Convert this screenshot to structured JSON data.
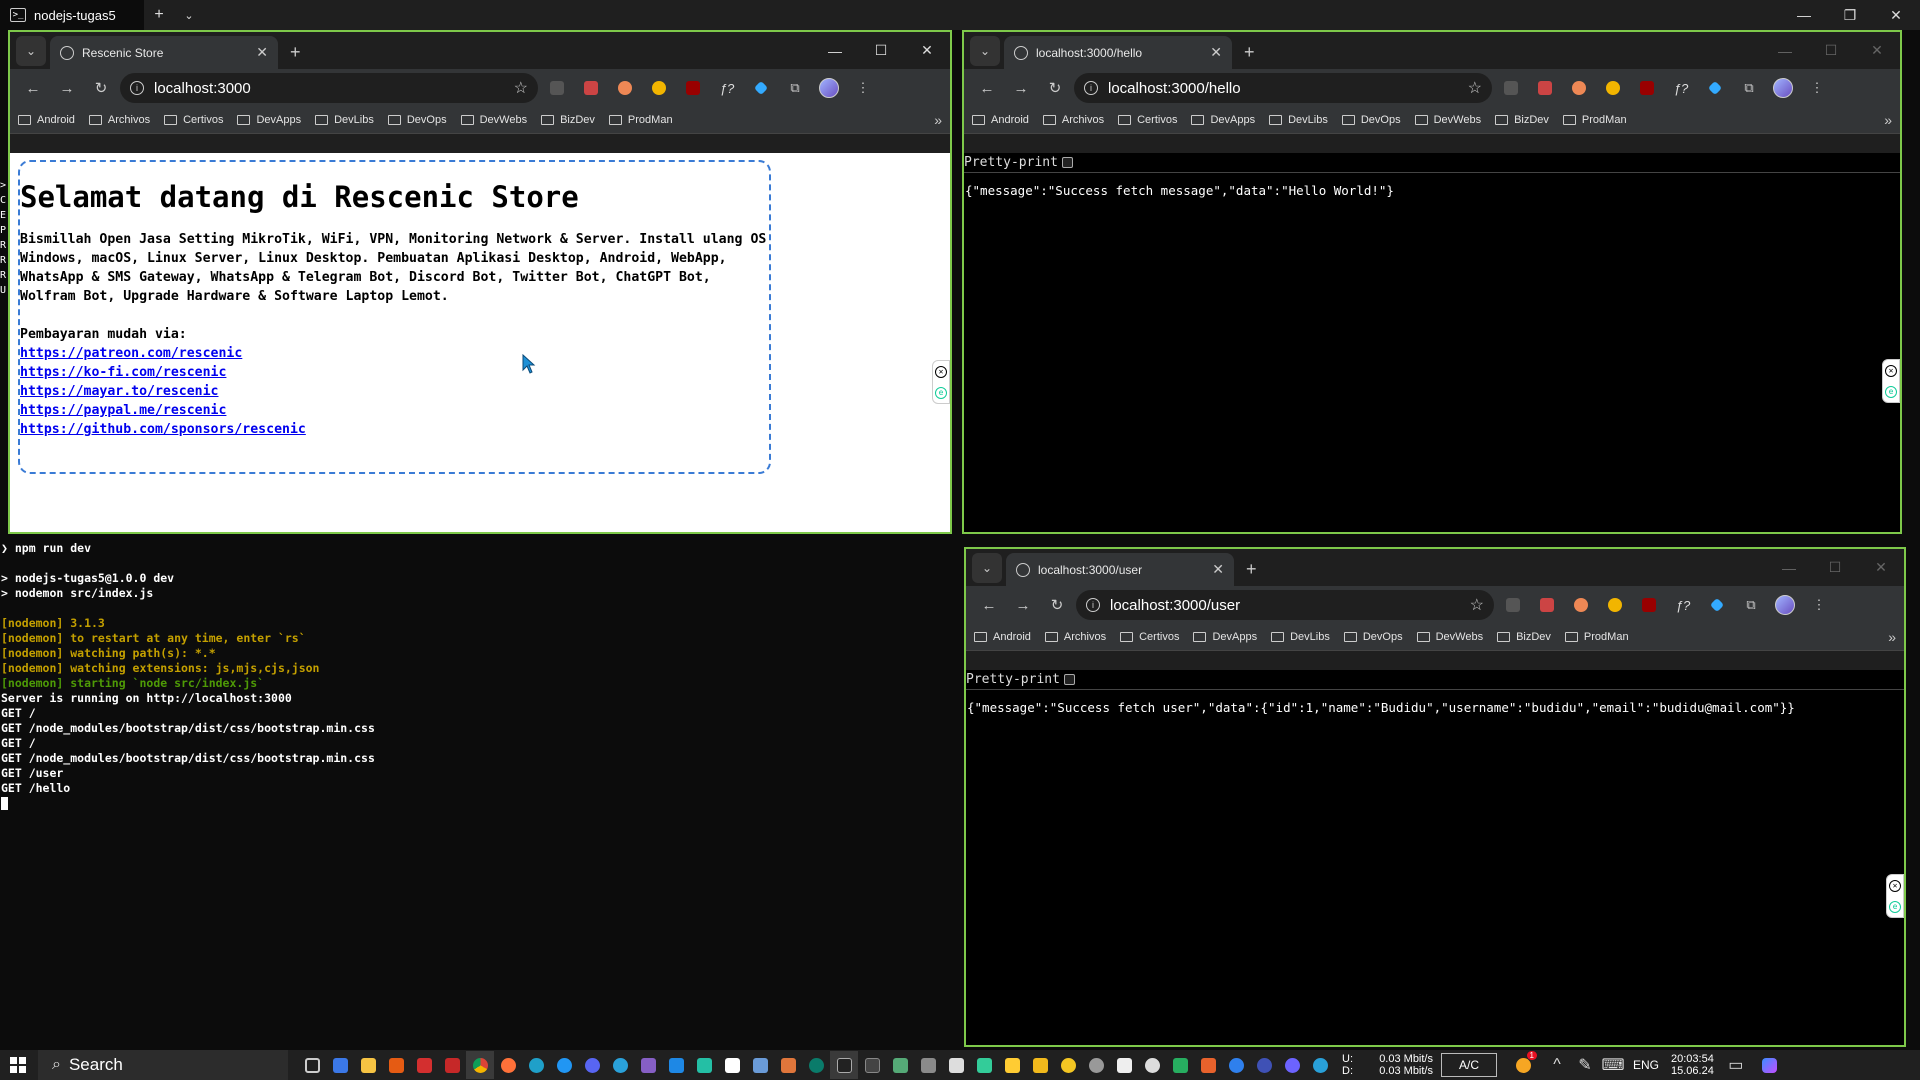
{
  "terminal": {
    "tab_title": "nodejs-tugas5",
    "tab_icon": "terminal-icon",
    "prompt_line": "npm run dev",
    "lines": [
      {
        "text": "",
        "color": "white"
      },
      {
        "text": "> nodejs-tugas5@1.0.0 dev",
        "color": "white"
      },
      {
        "text": "> nodemon src/index.js",
        "color": "white"
      },
      {
        "text": "",
        "color": "white"
      },
      {
        "text": "[nodemon] 3.1.3",
        "color": "yellow"
      },
      {
        "text": "[nodemon] to restart at any time, enter `rs`",
        "color": "yellow"
      },
      {
        "text": "[nodemon] watching path(s): *.*",
        "color": "yellow"
      },
      {
        "text": "[nodemon] watching extensions: js,mjs,cjs,json",
        "color": "yellow"
      },
      {
        "text": "[nodemon] starting `node src/index.js`",
        "color": "green"
      },
      {
        "text": "Server is running on http://localhost:3000",
        "color": "white"
      },
      {
        "text": "GET /",
        "color": "white"
      },
      {
        "text": "GET /node_modules/bootstrap/dist/css/bootstrap.min.css",
        "color": "white"
      },
      {
        "text": "GET /",
        "color": "white"
      },
      {
        "text": "GET /node_modules/bootstrap/dist/css/bootstrap.min.css",
        "color": "white"
      },
      {
        "text": "GET /user",
        "color": "white"
      },
      {
        "text": "GET /hello",
        "color": "white"
      }
    ],
    "left_edge_chars": ">CEPRRRU"
  },
  "bookmarks": [
    "Android",
    "Archivos",
    "Certivos",
    "DevApps",
    "DevLibs",
    "DevOps",
    "DevWebs",
    "BizDev",
    "ProdMan"
  ],
  "browser1": {
    "tab_title": "Rescenic Store",
    "url": "localhost:3000",
    "heading": "Selamat datang di Rescenic Store",
    "paragraph": "Bismillah Open Jasa Setting MikroTik, WiFi, VPN, Monitoring Network & Server. Install ulang OS Windows, macOS, Linux Server, Linux Desktop. Pembuatan Aplikasi Desktop, Android, WebApp, WhatsApp & SMS Gateway, WhatsApp & Telegram Bot, Discord Bot, Twitter Bot, ChatGPT Bot, Wolfram Bot, Upgrade Hardware & Software Laptop Lemot.",
    "payment_label": "Pembayaran mudah via:",
    "links": [
      "https://patreon.com/rescenic",
      "https://ko-fi.com/rescenic",
      "https://mayar.to/rescenic",
      "https://paypal.me/rescenic",
      "https://github.com/sponsors/rescenic"
    ]
  },
  "browser2": {
    "tab_title": "localhost:3000/hello",
    "url": "localhost:3000/hello",
    "pretty_print": "Pretty-print",
    "json": "{\"message\":\"Success fetch message\",\"data\":\"Hello World!\"}"
  },
  "browser3": {
    "tab_title": "localhost:3000/user",
    "url": "localhost:3000/user",
    "pretty_print": "Pretty-print",
    "json": "{\"message\":\"Success fetch user\",\"data\":{\"id\":1,\"name\":\"Budidu\",\"username\":\"budidu\",\"email\":\"budidu@mail.com\"}}"
  },
  "taskbar": {
    "search_label": "Search",
    "net_up_label": "U:",
    "net_down_label": "D:",
    "net_up": "0.03 Mbit/s",
    "net_down": "0.03 Mbit/s",
    "ac_label": "A/C",
    "lang": "ENG",
    "time": "20:03:54",
    "date": "15.06.24",
    "badge_count": "1"
  },
  "colors": {
    "window_border": "#7ec94a",
    "link": "#0000ee",
    "nodemon_yellow": "#c4a000",
    "nodemon_green": "#4e9a06"
  }
}
